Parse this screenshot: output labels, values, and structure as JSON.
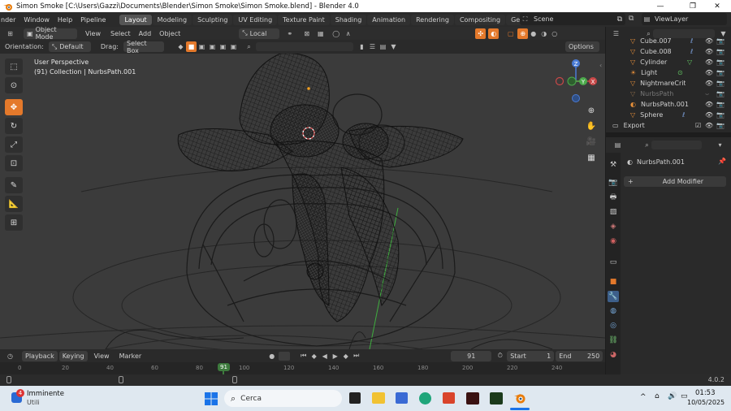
{
  "window": {
    "title": "Simon Smoke [C:\\Users\\Gazzi\\Documents\\Blender\\Simon Smoke\\Simon Smoke.blend] - Blender 4.0",
    "minimize": "—",
    "maximize": "❐",
    "close": "✕"
  },
  "menu": {
    "items": [
      "nder",
      "Window",
      "Help",
      "Pipeline"
    ],
    "workspaces": [
      "Layout",
      "Modeling",
      "Sculpting",
      "UV Editing",
      "Texture Paint",
      "Shading",
      "Animation",
      "Rendering",
      "Compositing",
      "Geometry Nodes"
    ],
    "active_workspace": "Layout",
    "scene_label": "Scene",
    "viewlayer_label": "ViewLayer"
  },
  "header": {
    "mode": "Object Mode",
    "view": "View",
    "select": "Select",
    "add": "Add",
    "object": "Object",
    "transform_orientation": "Local",
    "orientation_label": "Orientation:",
    "orientation_value": "Default",
    "drag_label": "Drag:",
    "drag_value": "Select Box",
    "options": "Options"
  },
  "viewport": {
    "perspective": "User Perspective",
    "collection": "(91) Collection | NurbsPath.001",
    "gizmo": {
      "x": "X",
      "y": "Y",
      "z": "Z"
    }
  },
  "outliner": {
    "items": [
      {
        "name": "Cube.007"
      },
      {
        "name": "Cube.008"
      },
      {
        "name": "Cylinder"
      },
      {
        "name": "Light"
      },
      {
        "name": "NightmareCritte"
      },
      {
        "name": "NurbsPath"
      },
      {
        "name": "NurbsPath.001"
      },
      {
        "name": "Sphere"
      },
      {
        "name": "Export"
      }
    ]
  },
  "properties": {
    "object_name": "NurbsPath.001",
    "add_modifier": "Add Modifier"
  },
  "timeline": {
    "playback": "Playback",
    "keying": "Keying",
    "view": "View",
    "marker": "Marker",
    "current_frame": "91",
    "start_label": "Start",
    "start": "1",
    "end_label": "End",
    "end": "250",
    "ruler": [
      "0",
      "20",
      "40",
      "60",
      "80",
      "91",
      "100",
      "120",
      "140",
      "160",
      "180",
      "200",
      "220",
      "240"
    ]
  },
  "statusbar": {
    "version": "4.0.2"
  },
  "taskbar": {
    "weather_badge": "4",
    "weather_title": "Imminente",
    "weather_sub": "Utili",
    "search_placeholder": "Cerca",
    "time": "01:53",
    "date": "10/05/2025",
    "chevron": "^"
  },
  "colors": {
    "accent": "#e4792b",
    "selected_frame": "#3d7a3d",
    "viewport_bg": "#3b3b3b"
  }
}
